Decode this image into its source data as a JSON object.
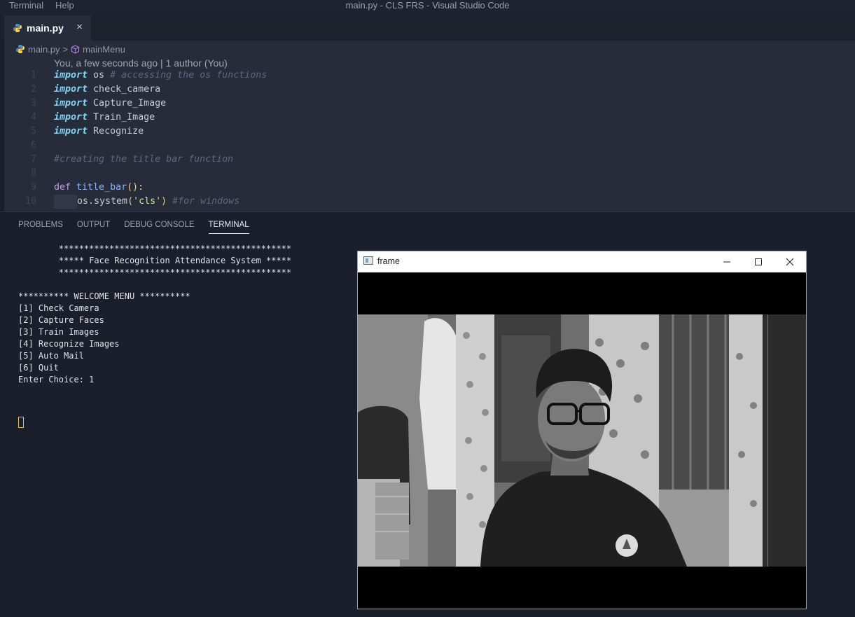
{
  "window": {
    "title": "main.py - CLS FRS - Visual Studio Code"
  },
  "menu": [
    "Terminal",
    "Help"
  ],
  "tab": {
    "label": "main.py",
    "close": "×"
  },
  "breadcrumb": {
    "file": "main.py",
    "separator": ">",
    "symbol": "mainMenu"
  },
  "blame": "You, a few seconds ago | 1 author (You)",
  "code": {
    "line_numbers": [
      "1",
      "2",
      "3",
      "4",
      "5",
      "6",
      "7",
      "8",
      "9",
      "10"
    ],
    "l1": {
      "kw": "import",
      "name": " os ",
      "comment": "# accessing the os functions"
    },
    "l2": {
      "kw": "import",
      "name": " check_camera"
    },
    "l3": {
      "kw": "import",
      "name": " Capture_Image"
    },
    "l4": {
      "kw": "import",
      "name": " Train_Image"
    },
    "l5": {
      "kw": "import",
      "name": " Recognize"
    },
    "l7": {
      "comment": "#creating the title bar function"
    },
    "l9": {
      "kw": "def",
      "fn": " title_bar",
      "parens": "():",
      "colon": ""
    },
    "l10": {
      "obj": "os.system",
      "open": "(",
      "str": "'cls'",
      "close": ")",
      "comment": " #for windows"
    }
  },
  "panel": {
    "tabs": [
      "PROBLEMS",
      "OUTPUT",
      "DEBUG CONSOLE",
      "TERMINAL"
    ],
    "active_tab": "TERMINAL"
  },
  "terminal": {
    "lines": [
      "        **********************************************",
      "        ***** Face Recognition Attendance System *****",
      "        **********************************************",
      "",
      "********** WELCOME MENU **********",
      "[1] Check Camera",
      "[2] Capture Faces",
      "[3] Train Images",
      "[4] Recognize Images",
      "[5] Auto Mail",
      "[6] Quit",
      "Enter Choice: 1"
    ],
    "cursor_color": "#e3c25a"
  },
  "frame_window": {
    "title": "frame",
    "buttons": {
      "minimize": "minimize-icon",
      "maximize": "maximize-icon",
      "close": "close-icon"
    }
  },
  "colors": {
    "editor_bg": "#272c3a",
    "panel_bg": "#1b1f2b",
    "keyword": "#86d3f5",
    "comment": "#5b6680"
  }
}
